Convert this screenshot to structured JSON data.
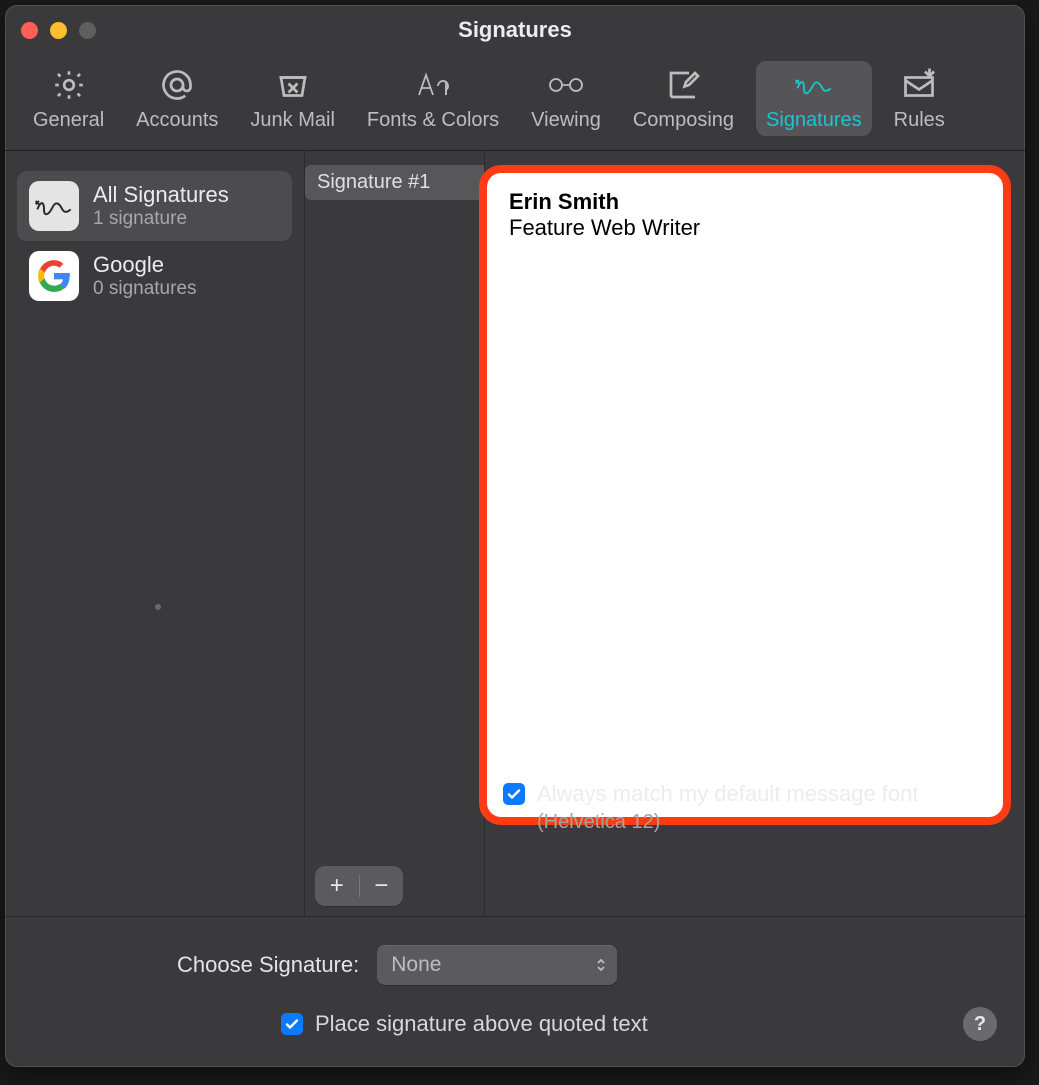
{
  "window": {
    "title": "Signatures"
  },
  "tabs": [
    {
      "id": "general",
      "label": "General"
    },
    {
      "id": "accounts",
      "label": "Accounts"
    },
    {
      "id": "junk",
      "label": "Junk Mail"
    },
    {
      "id": "fonts",
      "label": "Fonts & Colors"
    },
    {
      "id": "viewing",
      "label": "Viewing"
    },
    {
      "id": "composing",
      "label": "Composing"
    },
    {
      "id": "signatures",
      "label": "Signatures"
    },
    {
      "id": "rules",
      "label": "Rules"
    }
  ],
  "active_tab": "signatures",
  "accounts": [
    {
      "name": "All Signatures",
      "sub": "1 signature",
      "icon": "signature",
      "selected": true
    },
    {
      "name": "Google",
      "sub": "0 signatures",
      "icon": "google",
      "selected": false
    }
  ],
  "signature_list": [
    {
      "name": "Signature #1",
      "selected": true
    }
  ],
  "editor": {
    "line1": "Erin Smith",
    "line2": "Feature Web Writer"
  },
  "buttons": {
    "add": "+",
    "remove": "−"
  },
  "always_match": {
    "label": "Always match my default message font",
    "sub": "(Helvetica 12)",
    "checked": true
  },
  "choose": {
    "label": "Choose Signature:",
    "value": "None"
  },
  "place_above": {
    "label": "Place signature above quoted text",
    "checked": true
  },
  "help": "?"
}
